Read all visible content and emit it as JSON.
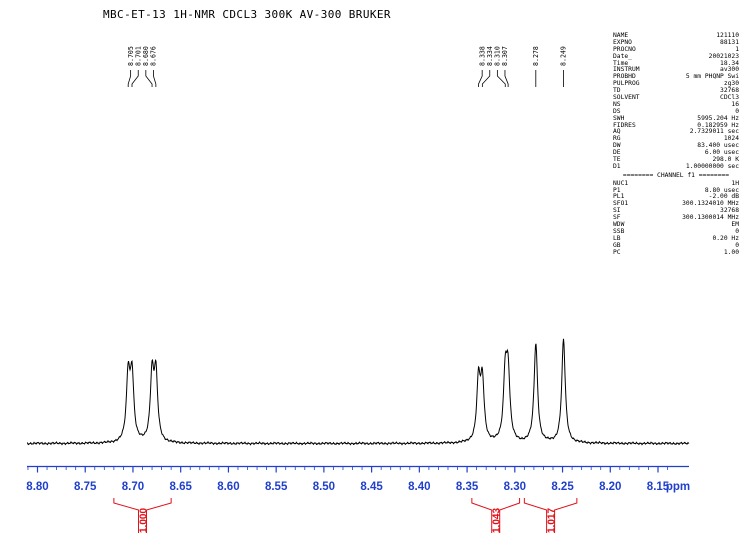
{
  "header": {
    "title": "MBC-ET-13 1H-NMR CDCL3 300K AV-300 BRUKER"
  },
  "parameters": {
    "block1": [
      {
        "key": "NAME",
        "value": "121110"
      },
      {
        "key": "EXPNO",
        "value": "88131"
      },
      {
        "key": "PROCNO",
        "value": "1"
      },
      {
        "key": "Date_",
        "value": "20021023"
      },
      {
        "key": "Time",
        "value": "18.34"
      },
      {
        "key": "INSTRUM",
        "value": "av300"
      },
      {
        "key": "PROBHD",
        "value": "5 mm PHQNP Swi"
      },
      {
        "key": "PULPROG",
        "value": "zg30"
      },
      {
        "key": "TD",
        "value": "32768"
      },
      {
        "key": "SOLVENT",
        "value": "CDCl3"
      },
      {
        "key": "NS",
        "value": "16"
      },
      {
        "key": "DS",
        "value": "0"
      },
      {
        "key": "SWH",
        "value": "5995.204 Hz"
      },
      {
        "key": "FIDRES",
        "value": "0.182959 Hz"
      },
      {
        "key": "AQ",
        "value": "2.7329011 sec"
      },
      {
        "key": "RG",
        "value": "1024"
      },
      {
        "key": "DW",
        "value": "83.400 usec"
      },
      {
        "key": "DE",
        "value": "6.00 usec"
      },
      {
        "key": "TE",
        "value": "298.0 K"
      },
      {
        "key": "D1",
        "value": "1.00000000 sec"
      }
    ],
    "channel_label": "======== CHANNEL f1 ========",
    "block2": [
      {
        "key": "NUC1",
        "value": "1H"
      },
      {
        "key": "P1",
        "value": "8.80 usec"
      },
      {
        "key": "PL1",
        "value": "-2.00 dB"
      },
      {
        "key": "SFO1",
        "value": "300.1324010 MHz"
      },
      {
        "key": "SI",
        "value": "32768"
      },
      {
        "key": "SF",
        "value": "300.1300014 MHz"
      },
      {
        "key": "WDW",
        "value": "EM"
      },
      {
        "key": "SSB",
        "value": "0"
      },
      {
        "key": "LB",
        "value": "0.20 Hz"
      },
      {
        "key": "GB",
        "value": "0"
      },
      {
        "key": "PC",
        "value": "1.00"
      }
    ]
  },
  "chart_data": {
    "type": "line",
    "title": "MBC-ET-13 1H-NMR CDCL3 300K AV-300 BRUKER",
    "xlabel": "ppm",
    "ylabel": "",
    "x_reversed": true,
    "xlim": [
      8.8,
      8.15
    ],
    "x_ticks": [
      "8.80",
      "8.75",
      "8.70",
      "8.65",
      "8.60",
      "8.55",
      "8.50",
      "8.45",
      "8.40",
      "8.35",
      "8.30",
      "8.25",
      "8.20",
      "8.15"
    ],
    "minor_tick_step": 0.01,
    "grid": false,
    "colors": {
      "spectrum": "#000000",
      "axis": "#1f3fcc",
      "integral": "#e0111a"
    },
    "peak_labels": [
      "8.705",
      "8.701",
      "8.680",
      "8.676",
      "8.338",
      "8.334",
      "8.310",
      "8.307",
      "8.278",
      "8.249"
    ],
    "peak_label_groups": [
      {
        "labels": [
          "8.705",
          "8.701",
          "8.680",
          "8.676"
        ]
      },
      {
        "labels": [
          "8.338",
          "8.334",
          "8.310",
          "8.307"
        ]
      },
      {
        "labels": [
          "8.278"
        ]
      },
      {
        "labels": [
          "8.249"
        ]
      }
    ],
    "peaks": [
      {
        "ppm": 8.705,
        "height": 0.64
      },
      {
        "ppm": 8.701,
        "height": 0.64
      },
      {
        "ppm": 8.68,
        "height": 0.64
      },
      {
        "ppm": 8.676,
        "height": 0.64
      },
      {
        "ppm": 8.338,
        "height": 0.59
      },
      {
        "ppm": 8.334,
        "height": 0.58
      },
      {
        "ppm": 8.31,
        "height": 0.64
      },
      {
        "ppm": 8.307,
        "height": 0.63
      },
      {
        "ppm": 8.278,
        "height": 0.96
      },
      {
        "ppm": 8.249,
        "height": 1.0
      }
    ],
    "integrals": [
      {
        "from": 8.72,
        "to": 8.66,
        "value": "1.000"
      },
      {
        "from": 8.345,
        "to": 8.295,
        "value": "1.043"
      },
      {
        "from": 8.29,
        "to": 8.235,
        "value": "1.017"
      }
    ]
  }
}
